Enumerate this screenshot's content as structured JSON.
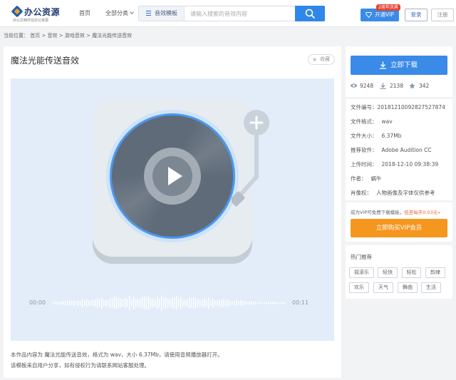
{
  "header": {
    "logo_text": "办公资源",
    "logo_sub": "办公文档尽在办公资源",
    "nav_home": "首页",
    "nav_category": "全部分类",
    "search_type": "音效模板",
    "search_placeholder": "请输入搜索的音效内容",
    "vip_label": "开通VIP",
    "vip_badge": "2周年庆典",
    "login_label": "登录",
    "register_label": "注册"
  },
  "breadcrumb": "当前位置：  首页 > 音效 > 游戏音效 > 魔法光能传送音效",
  "main": {
    "title": "魔法光能传送音效",
    "favorite_label": "收藏",
    "time_start": "00:00",
    "time_end": "00:11",
    "desc_line1": "本作品内容为 魔法光能传送音效，格式为 wav，大小 6.37Mb，请使用音频播放器打开。",
    "desc_line2": "该模板来自用户分享，如有侵权行为请联系网站客服处理。"
  },
  "download": {
    "button_label": "立即下载",
    "views": "9248",
    "downloads": "2138",
    "stars": "342"
  },
  "info": {
    "rows": [
      {
        "key": "文件编号：",
        "value": "20181210092827527874"
      },
      {
        "key": "文件格式：",
        "value": "wav"
      },
      {
        "key": "文件大小：",
        "value": "6.37Mb"
      },
      {
        "key": "推荐软件：",
        "value": "Adobe Audition CC"
      },
      {
        "key": "上传时间：",
        "value": "2018-12-10 09:38:39"
      },
      {
        "key": "作者：",
        "value": "蜗牛"
      },
      {
        "key": "肖像权：",
        "value": "人物画像及字体仅供参考"
      }
    ]
  },
  "vip": {
    "text": "成为VIP可免费下载模板，",
    "highlight": "低至每天0.03元»",
    "buy_label": "立即购买VIP会员"
  },
  "hot": {
    "title": "热门推荐",
    "tags": [
      "摇滚乐",
      "轻快",
      "轻松",
      "韵律",
      "欢乐",
      "天气",
      "舞曲",
      "生活"
    ]
  },
  "colors": {
    "accent": "#3a8ae8",
    "orange": "#f5961e",
    "player_bg": "#e3edf9"
  }
}
